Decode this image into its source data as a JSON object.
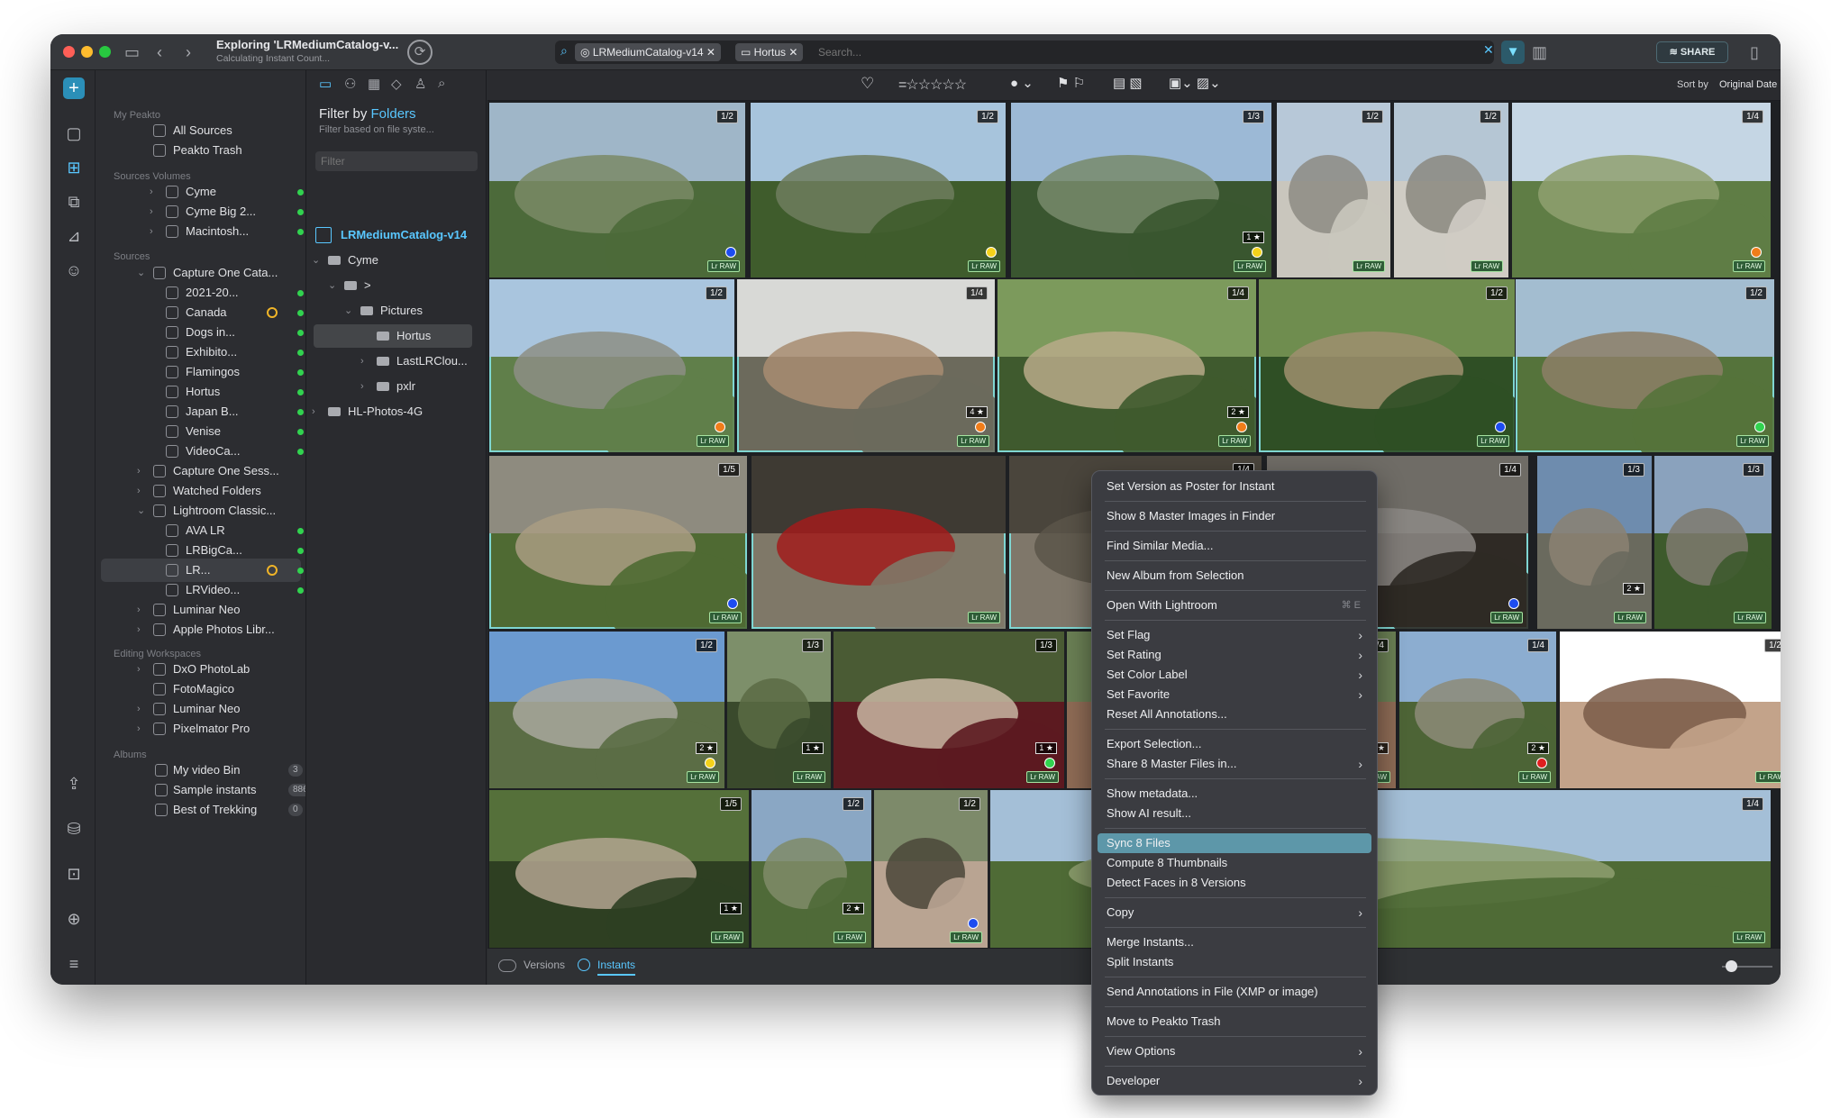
{
  "window": {
    "title": "Exploring 'LRMediumCatalog-v...",
    "subtitle": "Calculating Instant Count..."
  },
  "search": {
    "chips": [
      "LRMediumCatalog-v14",
      "Hortus"
    ],
    "placeholder": "Search...",
    "share_label": "SHARE"
  },
  "sidebar": {
    "sections": {
      "my_peakto": "My Peakto",
      "volumes": "Sources Volumes",
      "sources": "Sources",
      "editing": "Editing Workspaces",
      "albums": "Albums"
    },
    "my_peakto": [
      "All Sources",
      "Peakto Trash"
    ],
    "volumes": [
      "Cyme",
      "Cyme Big 2...",
      "Macintosh..."
    ],
    "sources": [
      "Capture One Cata...",
      "2021-20...",
      "Canada",
      "Dogs in...",
      "Exhibito...",
      "Flamingos",
      "Hortus",
      "Japan B...",
      "Venise",
      "VideoCa...",
      "Capture One Sess...",
      "Watched Folders",
      "Lightroom Classic...",
      "AVA LR",
      "LRBigCa...",
      "LR...",
      "LRVideo...",
      "Luminar Neo",
      "Apple Photos Libr..."
    ],
    "editing": [
      "DxO PhotoLab",
      "FotoMagico",
      "Luminar Neo",
      "Pixelmator Pro"
    ],
    "albums": [
      {
        "name": "My video Bin",
        "count": "3"
      },
      {
        "name": "Sample instants",
        "count": "886"
      },
      {
        "name": "Best of Trekking",
        "count": "0"
      }
    ]
  },
  "folders": {
    "filter_by": "Filter by",
    "filter_kind": "Folders",
    "subtitle": "Filter based on file syste...",
    "filter_placeholder": "Filter",
    "root": "LRMediumCatalog-v14",
    "tree": [
      "Cyme",
      ">",
      "Pictures",
      "Hortus",
      "LastLRClou...",
      "pxlr",
      "HL-Photos-4G"
    ]
  },
  "toolbar": {
    "sort_label": "Sort by",
    "sort_value": "Original Date"
  },
  "bottombar": {
    "versions_label": "Versions",
    "instants_label": "Instants"
  },
  "photos": [
    {
      "badge": "1/2",
      "dot": "#1d4cf0"
    },
    {
      "badge": "1/2",
      "dot": "#f4d21a"
    },
    {
      "badge": "1/3",
      "dot": "#f4d21a",
      "stars": "1 ★"
    },
    {
      "badge": "1/2",
      "dot": ""
    },
    {
      "badge": "1/2",
      "dot": ""
    },
    {
      "badge": "1/4",
      "dot": "#f07d1a"
    },
    {
      "badge": "1/2",
      "dot": "#f07d1a"
    },
    {
      "badge": "1/4",
      "dot": "#f07d1a",
      "stars": "4 ★"
    },
    {
      "badge": "1/4",
      "dot": "#f07d1a",
      "stars": "2 ★"
    },
    {
      "badge": "1/2",
      "dot": "#1d4cf0"
    },
    {
      "badge": "1/2",
      "dot": "#31d34f"
    },
    {
      "badge": "1/5",
      "dot": "#1d4cf0"
    },
    {
      "badge": "",
      "dot": ""
    },
    {
      "badge": "1/4",
      "dot": ""
    },
    {
      "badge": "1/4",
      "dot": "#1d4cf0"
    },
    {
      "badge": "1/3",
      "dot": "",
      "stars": "2 ★"
    },
    {
      "badge": "1/3",
      "dot": ""
    },
    {
      "badge": "1/2",
      "dot": "#f4d21a",
      "stars": "2 ★"
    },
    {
      "badge": "1/3",
      "dot": "",
      "stars": "1 ★"
    },
    {
      "badge": "1/3",
      "dot": "#31d34f",
      "stars": "1 ★"
    },
    {
      "badge": "1/4",
      "dot": "",
      "stars": "1 ★"
    },
    {
      "badge": "1/4",
      "dot": "#e01f1f",
      "stars": "2 ★"
    },
    {
      "badge": "1/2",
      "dot": ""
    },
    {
      "badge": "1/5",
      "dot": "",
      "stars": "1 ★"
    },
    {
      "badge": "1/2",
      "dot": "",
      "stars": "2 ★"
    },
    {
      "badge": "1/2",
      "dot": "#1d4cf0"
    },
    {
      "badge": "1/4",
      "dot": ""
    }
  ],
  "raw_tag": "Lr RAW",
  "context_menu": [
    {
      "label": "Set Version as Poster for Instant"
    },
    {
      "label": "Show 8 Master Images in Finder"
    },
    {
      "label": "Find Similar Media..."
    },
    {
      "label": "New Album from Selection"
    },
    {
      "label": "Open With Lightroom",
      "shortcut": "⌘ E"
    },
    {
      "label": "Set Flag",
      "sub": true
    },
    {
      "label": "Set Rating",
      "sub": true
    },
    {
      "label": "Set Color Label",
      "sub": true
    },
    {
      "label": "Set Favorite",
      "sub": true
    },
    {
      "label": "Reset All Annotations..."
    },
    {
      "label": "Export Selection..."
    },
    {
      "label": "Share 8 Master Files in...",
      "sub": true
    },
    {
      "label": "Show metadata..."
    },
    {
      "label": "Show AI result..."
    },
    {
      "label": "Sync 8 Files",
      "highlight": true
    },
    {
      "label": "Compute 8 Thumbnails"
    },
    {
      "label": "Detect Faces in 8 Versions"
    },
    {
      "label": "Copy",
      "sub": true
    },
    {
      "label": "Merge Instants..."
    },
    {
      "label": "Split Instants"
    },
    {
      "label": "Send Annotations in File (XMP or image)"
    },
    {
      "label": "Move to Peakto Trash"
    },
    {
      "label": "View Options",
      "sub": true
    },
    {
      "label": "Developer",
      "sub": true
    }
  ],
  "colors": {
    "accent": "#5d97a9",
    "folder_accent": "#59c7ff",
    "status_green": "#31d34f"
  }
}
